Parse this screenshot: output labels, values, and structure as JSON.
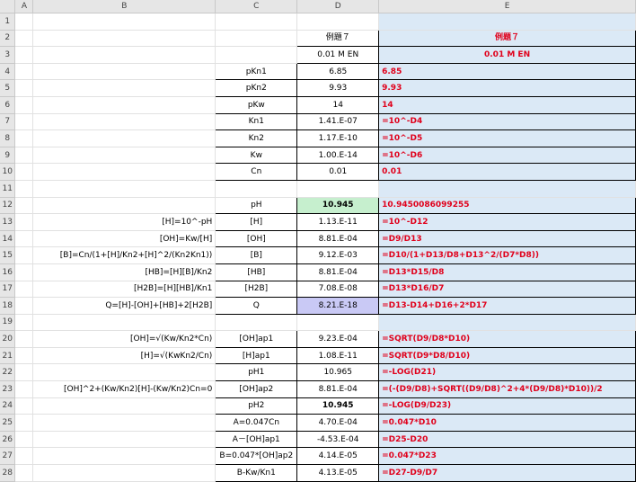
{
  "columns": [
    "A",
    "B",
    "C",
    "D",
    "E"
  ],
  "rows": [
    {
      "n": "1",
      "b": "",
      "c": "",
      "d": "",
      "e": ""
    },
    {
      "n": "2",
      "b": "",
      "c": "",
      "d": "例題７",
      "e": "例題７"
    },
    {
      "n": "3",
      "b": "",
      "c": "",
      "d": "0.01 M EN",
      "e": "0.01 M EN"
    },
    {
      "n": "4",
      "b": "",
      "c": "pKn1",
      "d": "6.85",
      "e": "6.85"
    },
    {
      "n": "5",
      "b": "",
      "c": "pKn2",
      "d": "9.93",
      "e": "9.93"
    },
    {
      "n": "6",
      "b": "",
      "c": "pKw",
      "d": "14",
      "e": "14"
    },
    {
      "n": "7",
      "b": "",
      "c": "Kn1",
      "d": "1.41.E-07",
      "e": "=10^-D4"
    },
    {
      "n": "8",
      "b": "",
      "c": "Kn2",
      "d": "1.17.E-10",
      "e": "=10^-D5"
    },
    {
      "n": "9",
      "b": "",
      "c": "Kw",
      "d": "1.00.E-14",
      "e": "=10^-D6"
    },
    {
      "n": "10",
      "b": "",
      "c": "Cn",
      "d": "0.01",
      "e": "0.01"
    },
    {
      "n": "11",
      "b": "",
      "c": "",
      "d": "",
      "e": ""
    },
    {
      "n": "12",
      "b": "",
      "c": "pH",
      "d": "10.945",
      "e": "10.9450086099255"
    },
    {
      "n": "13",
      "b": "[H]=10^-pH",
      "c": "[H]",
      "d": "1.13.E-11",
      "e": "=10^-D12"
    },
    {
      "n": "14",
      "b": "[OH]=Kw/[H]",
      "c": "[OH]",
      "d": "8.81.E-04",
      "e": "=D9/D13"
    },
    {
      "n": "15",
      "b": "[B]=Cn/(1+[H]/Kn2+[H]^2/(Kn2Kn1))",
      "c": "[B]",
      "d": "9.12.E-03",
      "e": "=D10/(1+D13/D8+D13^2/(D7*D8))"
    },
    {
      "n": "16",
      "b": "[HB]=[H][B]/Kn2",
      "c": "[HB]",
      "d": "8.81.E-04",
      "e": "=D13*D15/D8"
    },
    {
      "n": "17",
      "b": "[H2B]=[H][HB]/Kn1",
      "c": "[H2B]",
      "d": "7.08.E-08",
      "e": "=D13*D16/D7"
    },
    {
      "n": "18",
      "b": "Q=[H]-[OH]+[HB]+2[H2B]",
      "c": "Q",
      "d": "8.21.E-18",
      "e": "=D13-D14+D16+2*D17"
    },
    {
      "n": "19",
      "b": "",
      "c": "",
      "d": "",
      "e": ""
    },
    {
      "n": "20",
      "b": "[OH]=√(Kw/Kn2*Cn)",
      "c": "[OH]ap1",
      "d": "9.23.E-04",
      "e": "=SQRT(D9/D8*D10)"
    },
    {
      "n": "21",
      "b": "[H]=√(KwKn2/Cn)",
      "c": "[H]ap1",
      "d": "1.08.E-11",
      "e": "=SQRT(D9*D8/D10)"
    },
    {
      "n": "22",
      "b": "",
      "c": "pH1",
      "d": "10.965",
      "e": "=-LOG(D21)"
    },
    {
      "n": "23",
      "b": "[OH]^2+(Kw/Kn2)[H]-(Kw/Kn2)Cn=0",
      "c": "[OH]ap2",
      "d": "8.81.E-04",
      "e": "=(-(D9/D8)+SQRT((D9/D8)^2+4*(D9/D8)*D10))/2"
    },
    {
      "n": "24",
      "b": "",
      "c": "pH2",
      "d": "10.945",
      "e": "=-LOG(D9/D23)"
    },
    {
      "n": "25",
      "b": "",
      "c": "A=0.047Cn",
      "d": "4.70.E-04",
      "e": "=0.047*D10"
    },
    {
      "n": "26",
      "b": "",
      "c": "A－[OH]ap1",
      "d": "-4.53.E-04",
      "e": "=D25-D20"
    },
    {
      "n": "27",
      "b": "",
      "c": "B=0.047*[OH]ap2",
      "d": "4.14.E-05",
      "e": "=0.047*D23"
    },
    {
      "n": "28",
      "b": "",
      "c": "B-Kw/Kn1",
      "d": "4.13.E-05",
      "e": "=D27-D9/D7"
    }
  ]
}
